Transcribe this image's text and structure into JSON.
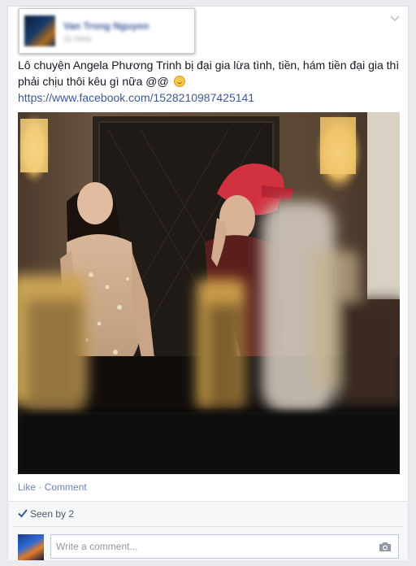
{
  "post": {
    "author_name": "Van Trong Nguyen",
    "timestamp": "11 mins",
    "text": "Lô chuyện Angela Phương Trinh bị đại gia lừa tình, tiền, hám tiền đại gia thì phải chịu thôi kêu gì nữa @@",
    "link": "https://www.facebook.com/1528210987425141",
    "emoji_icon": "wink-smile-emoji",
    "photo_icon": "post-photo"
  },
  "actions": {
    "like": "Like",
    "separator": "·",
    "comment": "Comment"
  },
  "ufi": {
    "seen_by": "Seen by 2",
    "comment_placeholder": "Write a comment..."
  },
  "colors": {
    "link": "#3b5998",
    "action": "#6d84b4",
    "background": "#e9ebee"
  }
}
